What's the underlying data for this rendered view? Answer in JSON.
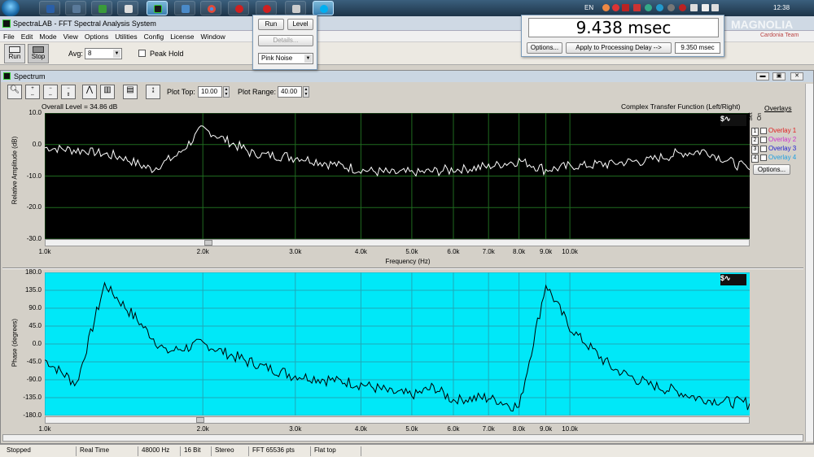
{
  "taskbar": {
    "lang": "EN",
    "time": "12:38"
  },
  "window": {
    "title": "SpectraLAB - FFT Spectral Analysis System"
  },
  "menu": [
    "File",
    "Edit",
    "Mode",
    "View",
    "Options",
    "Utilities",
    "Config",
    "License",
    "Window"
  ],
  "toolbar": {
    "run_label": "Run",
    "stop_label": "Stop",
    "avg_label": "Avg:",
    "avg_value": "8",
    "peak_hold_label": "Peak Hold"
  },
  "generator_popup": {
    "run_label": "Run",
    "level_label": "Level",
    "details_label": "Details...",
    "signal_value": "Pink Noise"
  },
  "delay_popup": {
    "readout": "9.438 msec",
    "options_label": "Options...",
    "apply_label": "Apply to Processing Delay -->",
    "delay_value": "9.350 msec"
  },
  "watermark": {
    "brand": "MAGNOLIA",
    "sub": "Cardonia Team"
  },
  "spectrum": {
    "title": "Spectrum",
    "plot_top_label": "Plot Top:",
    "plot_top_value": "10.00",
    "plot_range_label": "Plot Range:",
    "plot_range_value": "40.00",
    "overall_level": "Overall Level = 34.86 dB",
    "transfer_label": "Complex Transfer Function (Left/Right)",
    "amp": {
      "ylabel": "Relative Amplitude (dB)",
      "ticks": [
        "10.0",
        "0.0",
        "-10.0",
        "-20.0",
        "-30.0"
      ],
      "xlabel": "Frequency (Hz)"
    },
    "phase": {
      "ylabel": "Phase (degrees)",
      "ticks": [
        "180.0",
        "135.0",
        "90.0",
        "45.0",
        "0.0",
        "-45.0",
        "-90.0",
        "-135.0",
        "-180.0"
      ]
    },
    "xticks": [
      "1.0k",
      "2.0k",
      "3.0k",
      "4.0k",
      "5.0k",
      "6.0k",
      "7.0k",
      "8.0k",
      "9.0k",
      "10.0k"
    ],
    "overlays": {
      "title": "Overlays",
      "set_label": "Set",
      "on_label": "On",
      "options_label": "Options...",
      "items": [
        {
          "num": "1",
          "name": "Overlay 1",
          "color": "#e02020"
        },
        {
          "num": "2",
          "name": "Overlay 2",
          "color": "#cc33cc"
        },
        {
          "num": "3",
          "name": "Overlay 3",
          "color": "#2020d0"
        },
        {
          "num": "4",
          "name": "Overlay 4",
          "color": "#20a0e0"
        }
      ]
    }
  },
  "chart_data": [
    {
      "type": "line",
      "title": "Complex Transfer Function (Left/Right)",
      "xlabel": "Frequency (Hz)",
      "ylabel": "Relative Amplitude (dB)",
      "ylim": [
        -30,
        10
      ],
      "xscale": "log",
      "xlim": [
        1000,
        22000
      ],
      "x": [
        1000,
        1200,
        1400,
        1600,
        1800,
        2000,
        2500,
        3000,
        3500,
        4000,
        4500,
        5000,
        6000,
        7000,
        8000,
        9000,
        10000,
        12000,
        14000,
        16000,
        18000,
        22000
      ],
      "series": [
        {
          "values": [
            -1,
            -2,
            -4,
            -8,
            -3,
            5,
            -3,
            -4,
            -6,
            -8,
            -9,
            -9,
            -8,
            -7,
            -5,
            -8,
            -7,
            -6,
            -5,
            -3,
            -2,
            -8
          ]
        }
      ]
    },
    {
      "type": "line",
      "xlabel": "Frequency (Hz)",
      "ylabel": "Phase (degrees)",
      "ylim": [
        -180,
        180
      ],
      "xscale": "log",
      "xlim": [
        1000,
        22000
      ],
      "x": [
        1000,
        1150,
        1300,
        1500,
        1700,
        2000,
        2500,
        3000,
        3500,
        4000,
        4500,
        5000,
        5500,
        6000,
        7000,
        8000,
        9000,
        10000,
        12000,
        14000,
        16000,
        18000,
        22000
      ],
      "series": [
        {
          "values": [
            -40,
            -100,
            150,
            60,
            -20,
            0,
            -50,
            -80,
            -90,
            -100,
            -120,
            -130,
            -110,
            -140,
            -135,
            -160,
            150,
            40,
            -60,
            -100,
            -120,
            -140,
            -150
          ]
        }
      ]
    }
  ],
  "status": {
    "state": "Stopped",
    "mode": "Real Time",
    "rate": "48000 Hz",
    "bits": "16 Bit",
    "channels": "Stereo",
    "fft": "FFT 65536 pts",
    "window": "Flat top"
  }
}
